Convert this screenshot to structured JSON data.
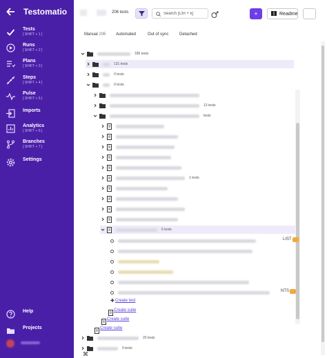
{
  "app": {
    "title": "Testomatio"
  },
  "sidebar": {
    "items": [
      {
        "label": "Tests",
        "shortcut": "[ SHIFT + 1 ]",
        "icon": "check-icon"
      },
      {
        "label": "Runs",
        "shortcut": "[ SHIFT + 2 ]",
        "icon": "play-icon"
      },
      {
        "label": "Plans",
        "shortcut": "[ SHIFT + 3 ]",
        "icon": "list-check-icon"
      },
      {
        "label": "Steps",
        "shortcut": "[ SHIFT + 4 ]",
        "icon": "steps-icon"
      },
      {
        "label": "Pulse",
        "shortcut": "[ SHIFT + 5 ]",
        "icon": "pulse-icon"
      },
      {
        "label": "Imports",
        "shortcut": "",
        "icon": "import-icon"
      },
      {
        "label": "Analytics",
        "shortcut": "[ SHIFT + 6 ]",
        "icon": "analytics-icon"
      },
      {
        "label": "Branches",
        "shortcut": "[ SHIFT + 7 ]",
        "icon": "branch-icon"
      },
      {
        "label": "Settings",
        "shortcut": "",
        "icon": "gear-icon"
      }
    ],
    "bottom": [
      {
        "label": "Help",
        "icon": "help-icon"
      },
      {
        "label": "Projects",
        "icon": "folder-icon"
      }
    ]
  },
  "toolbar": {
    "tests_count": "206 tests",
    "search_placeholder": "Search [Ctrl + k]",
    "readme_label": "Readme",
    "add_label": "+"
  },
  "tabs": [
    {
      "label": "Manual",
      "count": "206"
    },
    {
      "label": "Automated",
      "count": ""
    },
    {
      "label": "Out of sync",
      "count": ""
    },
    {
      "label": "Detached",
      "count": ""
    }
  ],
  "tree": {
    "root_count": "186 tests",
    "suite_a_count": "131 tests",
    "suite_b_count": "0 tests",
    "suite_c_count": "0 tests",
    "sub_count_1": "13 tests",
    "sub_count_2": "tests",
    "leaf_count_1": "1 tests",
    "leaf_count_2": "6 tests",
    "bottom_count_1": "20 tests",
    "bottom_count_2": "0 tests",
    "test_tail_1": "LIST",
    "test_tail_2": "NTS",
    "create_test": "Create test",
    "create_suite": "Create suite"
  },
  "colors": {
    "sidebar": "#4a1fa8",
    "accent": "#6d3ee8",
    "highlight": "#eeeaf9",
    "tag": "#f2a93b"
  }
}
